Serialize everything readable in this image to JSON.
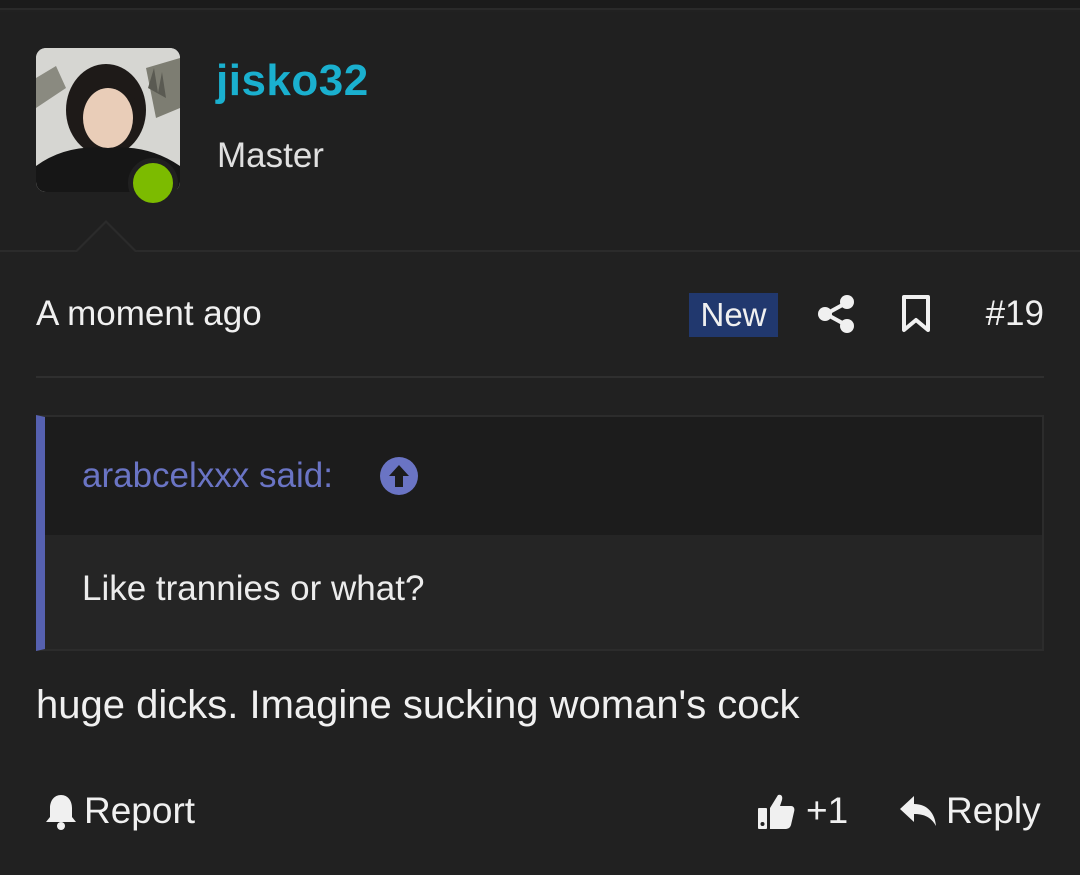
{
  "user": {
    "username": "jisko32",
    "title": "Master",
    "online_color": "#7cbb00",
    "avatar_icon": "user-avatar-photo"
  },
  "meta": {
    "time": "A moment ago",
    "badge": "New",
    "share_icon": "share-icon",
    "bookmark_icon": "bookmark-icon",
    "post_number": "#19"
  },
  "quote": {
    "author": "arabcelxxx said:",
    "jump_icon": "arrow-up-circle-icon",
    "text": "Like trannies or what?"
  },
  "post": {
    "body": "huge dicks. Imagine sucking woman's cock"
  },
  "actions": {
    "report_label": "Report",
    "like_count": "+1",
    "reply_label": "Reply"
  },
  "colors": {
    "username": "#1ab0cf",
    "quote_accent": "#5661b0",
    "badge_bg": "#21386e"
  }
}
